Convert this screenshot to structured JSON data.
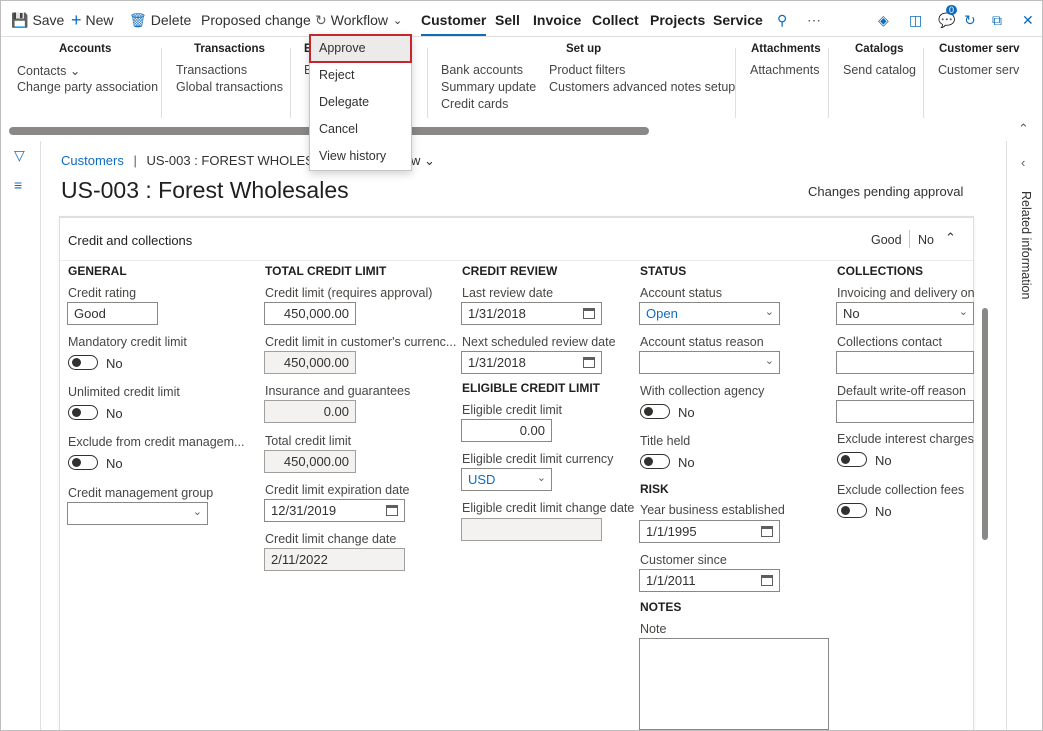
{
  "topbar": {
    "save": "Save",
    "new": "New",
    "delete": "Delete",
    "proposed_change": "Proposed change",
    "workflow": "Workflow",
    "tabs": [
      "Customer",
      "Sell",
      "Invoice",
      "Collect",
      "Projects",
      "Service"
    ],
    "search_icon": "search-icon",
    "more": "⋯",
    "notification_count": "0"
  },
  "ribbon": {
    "groups": [
      {
        "title": "Accounts",
        "items": [
          "Contacts",
          "Change party association"
        ]
      },
      {
        "title": "Transactions",
        "items": [
          "Transactions",
          "Global transactions"
        ]
      },
      {
        "title": "E",
        "items": [
          "B"
        ]
      },
      {
        "title": "Set up",
        "items": [
          "Bank accounts",
          "Summary update",
          "Credit cards",
          "Product filters",
          "Customers advanced notes setup"
        ]
      },
      {
        "title": "Attachments",
        "items": [
          "Attachments"
        ]
      },
      {
        "title": "Catalogs",
        "items": [
          "Send catalog"
        ]
      },
      {
        "title": "Customer serv",
        "items": [
          "Customer serv"
        ]
      }
    ],
    "hidden_frag": "t"
  },
  "workflow_menu": {
    "items": [
      "Approve",
      "Reject",
      "Delegate",
      "Cancel",
      "View history"
    ],
    "selected": "Approve"
  },
  "breadcrumb": {
    "root": "Customers",
    "sep": "|",
    "current": "US-003 : FOREST WHOLESAL",
    "trailing": "w"
  },
  "page": {
    "title": "US-003 : Forest Wholesales",
    "status": "Changes pending approval"
  },
  "related_information": "Related information",
  "fasttab": {
    "title": "Credit and collections",
    "summary_1": "Good",
    "summary_2": "No",
    "general": {
      "header": "GENERAL",
      "credit_rating_label": "Credit rating",
      "credit_rating": "Good",
      "mandatory_label": "Mandatory credit limit",
      "mandatory": "No",
      "unlimited_label": "Unlimited credit limit",
      "unlimited": "No",
      "exclude_label": "Exclude from credit managem...",
      "exclude": "No",
      "group_label": "Credit management group",
      "group": ""
    },
    "total": {
      "header": "TOTAL CREDIT LIMIT",
      "limit_label": "Credit limit (requires approval)",
      "limit": "450,000.00",
      "cust_cur_label": "Credit limit in customer's currenc...",
      "cust_cur": "450,000.00",
      "insurance_label": "Insurance and guarantees",
      "insurance": "0.00",
      "total_label": "Total credit limit",
      "total": "450,000.00",
      "exp_label": "Credit limit expiration date",
      "exp": "12/31/2019",
      "change_label": "Credit limit change date",
      "change": "2/11/2022"
    },
    "review": {
      "header": "CREDIT REVIEW",
      "last_label": "Last review date",
      "last": "1/31/2018",
      "next_label": "Next scheduled review date",
      "next": "1/31/2018",
      "eligible_header": "ELIGIBLE CREDIT LIMIT",
      "eligible_label": "Eligible credit limit",
      "eligible": "0.00",
      "currency_label": "Eligible credit limit currency",
      "currency": "USD",
      "elig_change_label": "Eligible credit limit change date",
      "elig_change": ""
    },
    "status": {
      "header": "STATUS",
      "acct_label": "Account status",
      "acct": "Open",
      "reason_label": "Account status reason",
      "reason": "",
      "agency_label": "With collection agency",
      "agency": "No",
      "title_label": "Title held",
      "title": "No",
      "risk_header": "RISK",
      "year_label": "Year business established",
      "year": "1/1/1995",
      "since_label": "Customer since",
      "since": "1/1/2011",
      "notes_header": "NOTES",
      "note_label": "Note",
      "note": ""
    },
    "collections": {
      "header": "COLLECTIONS",
      "invoicing_label": "Invoicing and delivery on",
      "invoicing": "No",
      "contact_label": "Collections contact",
      "contact": "",
      "writeoff_label": "Default write-off reason",
      "writeoff": "",
      "interest_label": "Exclude interest charges",
      "interest": "No",
      "fees_label": "Exclude collection fees",
      "fees": "No"
    }
  }
}
